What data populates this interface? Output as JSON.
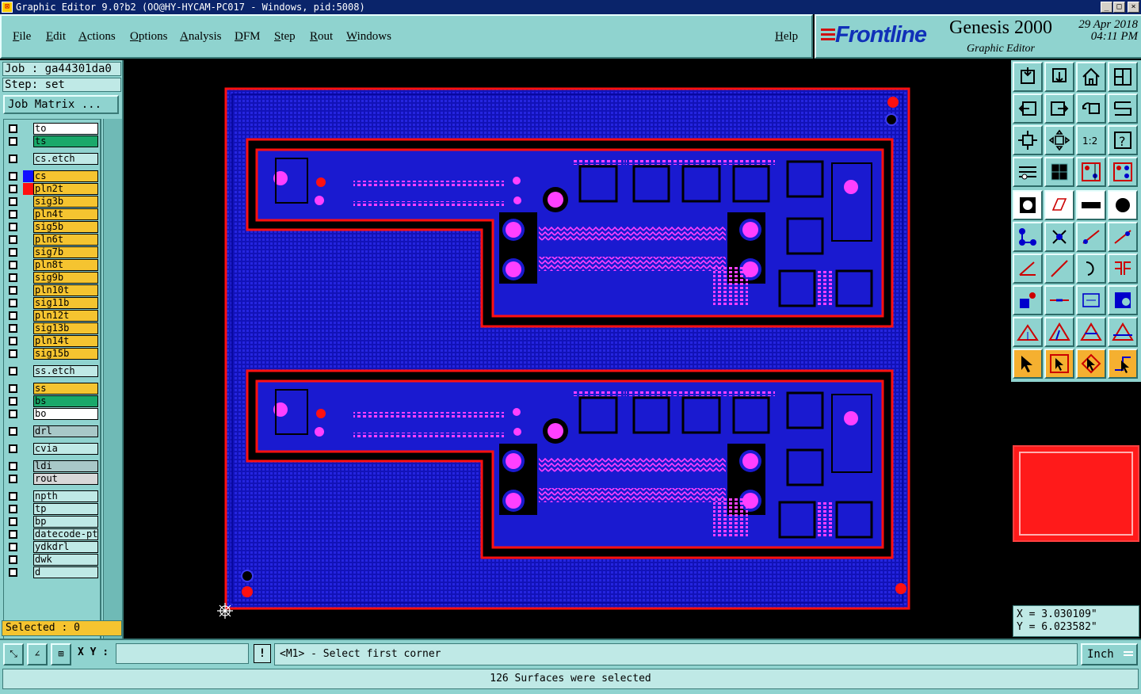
{
  "window": {
    "title": "Graphic Editor 9.0?b2 (OO@HY-HYCAM-PC017 - Windows, pid:5008)",
    "minimize": "_",
    "maximize": "□",
    "close": "×"
  },
  "menu": [
    "File",
    "Edit",
    "Actions",
    "Options",
    "Analysis",
    "DFM",
    "Step",
    "Rout",
    "Windows"
  ],
  "help_label": "Help",
  "brand": {
    "logo": "Frontline",
    "product": "Genesis 2000",
    "subtitle": "Graphic Editor",
    "date": "29 Apr 2018",
    "time": "04:11 PM"
  },
  "job": {
    "job_line": "Job : ga44301da0",
    "step_line": "Step: set",
    "matrix_button": "Job Matrix ..."
  },
  "layers": [
    {
      "name": "to",
      "color": "#ffffff",
      "swatch": ""
    },
    {
      "name": "ts",
      "color": "#1aa86a",
      "swatch": ""
    },
    {
      "name": "cs.etch",
      "color": "#bfe9e6",
      "swatch": ""
    },
    {
      "name": "cs",
      "color": "#f5c430",
      "swatch": "#1010ff"
    },
    {
      "name": "pln2t",
      "color": "#f5c430",
      "swatch": "#ff1010"
    },
    {
      "name": "sig3b",
      "color": "#f5c430",
      "swatch": ""
    },
    {
      "name": "pln4t",
      "color": "#f5c430",
      "swatch": ""
    },
    {
      "name": "sig5b",
      "color": "#f5c430",
      "swatch": ""
    },
    {
      "name": "pln6t",
      "color": "#f5c430",
      "swatch": ""
    },
    {
      "name": "sig7b",
      "color": "#f5c430",
      "swatch": ""
    },
    {
      "name": "pln8t",
      "color": "#f5c430",
      "swatch": ""
    },
    {
      "name": "sig9b",
      "color": "#f5c430",
      "swatch": ""
    },
    {
      "name": "pln10t",
      "color": "#f5c430",
      "swatch": ""
    },
    {
      "name": "sig11b",
      "color": "#f5c430",
      "swatch": ""
    },
    {
      "name": "pln12t",
      "color": "#f5c430",
      "swatch": ""
    },
    {
      "name": "sig13b",
      "color": "#f5c430",
      "swatch": ""
    },
    {
      "name": "pln14t",
      "color": "#f5c430",
      "swatch": ""
    },
    {
      "name": "sig15b",
      "color": "#f5c430",
      "swatch": ""
    },
    {
      "name": "ss.etch",
      "color": "#bfe9e6",
      "swatch": ""
    },
    {
      "name": "ss",
      "color": "#f5c430",
      "swatch": ""
    },
    {
      "name": "bs",
      "color": "#1aa86a",
      "swatch": ""
    },
    {
      "name": "bo",
      "color": "#ffffff",
      "swatch": ""
    },
    {
      "name": "drl",
      "color": "#a8c8c8",
      "swatch": ""
    },
    {
      "name": "cvia",
      "color": "#bfe9e6",
      "swatch": ""
    },
    {
      "name": "ldi",
      "color": "#a8c8c8",
      "swatch": ""
    },
    {
      "name": "rout",
      "color": "#d8d8d8",
      "swatch": ""
    },
    {
      "name": "npth",
      "color": "#bfe9e6",
      "swatch": ""
    },
    {
      "name": "tp",
      "color": "#bfe9e6",
      "swatch": ""
    },
    {
      "name": "bp",
      "color": "#bfe9e6",
      "swatch": ""
    },
    {
      "name": "datecode-pt",
      "color": "#bfe9e6",
      "swatch": ""
    },
    {
      "name": "ydkdrl",
      "color": "#bfe9e6",
      "swatch": ""
    },
    {
      "name": "dwk",
      "color": "#bfe9e6",
      "swatch": ""
    },
    {
      "name": "d",
      "color": "#bfe9e6",
      "swatch": ""
    }
  ],
  "selected_text": "Selected : 0",
  "coords": {
    "x": "X = 3.030109\"",
    "y": "Y = 6.023582\""
  },
  "bottom": {
    "xy_label": "X Y :",
    "xy_value": "",
    "bang": "!",
    "prompt": "<M1> - Select first corner",
    "units": "Inch"
  },
  "status": "126 Surfaces were selected",
  "colors": {
    "accent": "#8fd3cf",
    "board_bg": "#1a1ad0",
    "trace": "#ff1010",
    "pad": "#ff40ff"
  }
}
